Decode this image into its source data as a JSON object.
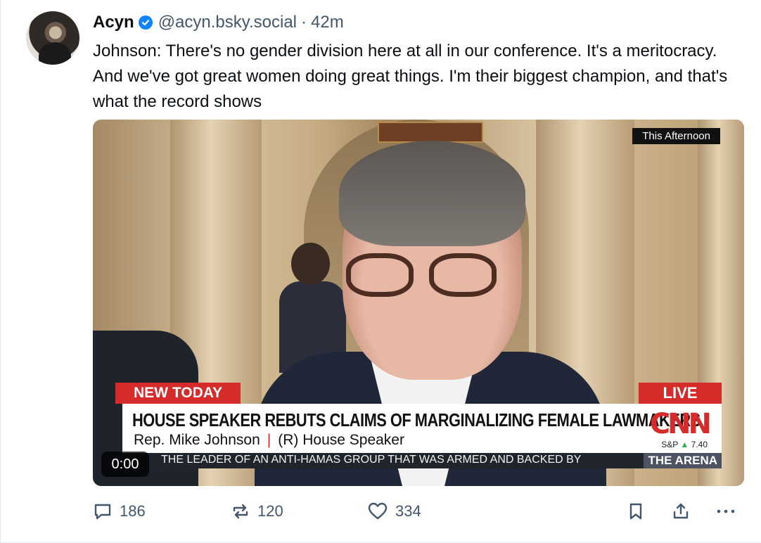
{
  "post": {
    "author_name": "Acyn",
    "handle": "@acyn.bsky.social",
    "separator": "·",
    "time": "42m",
    "text": "Johnson: There's no gender division here at all in our conference. It's a meritocracy. And we've got great women doing great things. I'm their biggest champion, and that's what the record shows"
  },
  "video": {
    "corner_tag": "This Afternoon",
    "banner_label": "NEW TODAY",
    "live_label": "LIVE",
    "headline": "HOUSE SPEAKER REBUTS CLAIMS OF MARGINALIZING FEMALE LAWMAKERS",
    "speaker_name": "Rep. Mike Johnson",
    "speaker_sep": "|",
    "speaker_title": "(R) House Speaker",
    "network_logo": "CNN",
    "market_label": "S&P",
    "market_arrow": "▲",
    "market_value": "7.40",
    "ticker": "THE LEADER OF AN ANTI-HAMAS GROUP THAT WAS ARMED AND BACKED BY",
    "ticker_tag": "THE ARENA",
    "timecode": "0:00"
  },
  "actions": {
    "replies": "186",
    "reposts": "120",
    "likes": "334"
  },
  "colors": {
    "verified": "#1083fe",
    "muted": "#42576c",
    "cnn_red": "#d52b2b"
  },
  "icons": [
    "verified-badge-icon",
    "reply-icon",
    "repost-icon",
    "like-icon",
    "bookmark-icon",
    "share-icon",
    "more-icon"
  ]
}
